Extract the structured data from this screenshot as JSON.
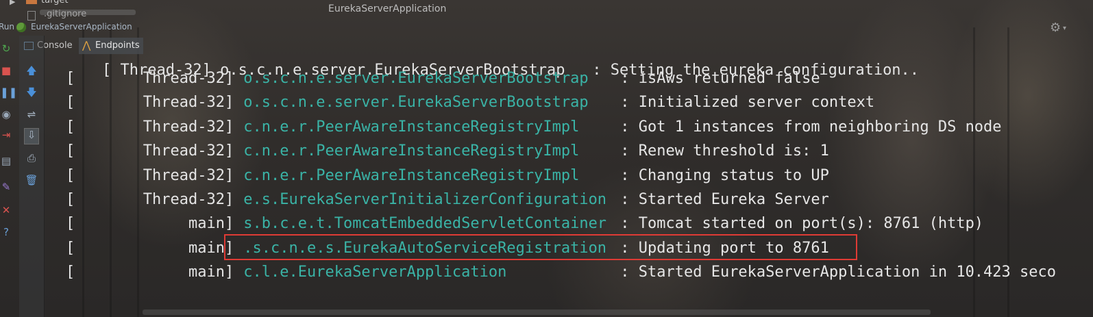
{
  "project_tree": {
    "folder_label": "target",
    "file_label": ".gitignore"
  },
  "editor": {
    "tab_title": "EurekaServerApplication"
  },
  "run_panel": {
    "label": "Run",
    "config_name": "EurekaServerApplication"
  },
  "tabs": {
    "console_label": "Console",
    "endpoints_label": "Endpoints",
    "active": "Endpoints"
  },
  "console": {
    "partial_top_line": "[ Thread-32] o.s.c.n.e.server.EurekaServerBootstrap   : Setting the eureka configuration..",
    "lines": [
      {
        "thread": "Thread-32]",
        "logger": "o.s.c.n.e.server.EurekaServerBootstrap",
        "message": ": isAws returned false"
      },
      {
        "thread": "Thread-32]",
        "logger": "o.s.c.n.e.server.EurekaServerBootstrap",
        "message": ": Initialized server context"
      },
      {
        "thread": "Thread-32]",
        "logger": "c.n.e.r.PeerAwareInstanceRegistryImpl",
        "message": ": Got 1 instances from neighboring DS node"
      },
      {
        "thread": "Thread-32]",
        "logger": "c.n.e.r.PeerAwareInstanceRegistryImpl",
        "message": ": Renew threshold is: 1"
      },
      {
        "thread": "Thread-32]",
        "logger": "c.n.e.r.PeerAwareInstanceRegistryImpl",
        "message": ": Changing status to UP"
      },
      {
        "thread": "Thread-32]",
        "logger": "e.s.EurekaServerInitializerConfiguration",
        "message": ": Started Eureka Server"
      },
      {
        "thread": "main]",
        "logger": "s.b.c.e.t.TomcatEmbeddedServletContainer",
        "message": ": Tomcat started on port(s): 8761 (http)"
      },
      {
        "thread": "main]",
        "logger": ".s.c.n.e.s.EurekaAutoServiceRegistration",
        "message": ": Updating port to 8761"
      },
      {
        "thread": "main]",
        "logger": "c.l.e.EurekaServerApplication",
        "message": ": Started EurekaServerApplication in 10.423 seco"
      }
    ],
    "highlighted_line_index": 7
  },
  "colors": {
    "logger": "#3ab3a6",
    "text": "#e4e4e4",
    "highlight_border": "#e03b35"
  },
  "icons": {
    "strip_a": [
      "rerun-icon",
      "stop-icon",
      "pause-icon",
      "dump-threads-icon",
      "exit-icon",
      "layout-icon",
      "pin-icon",
      "close-icon",
      "help-icon"
    ],
    "strip_b": [
      "up-arrow-icon",
      "down-arrow-icon",
      "soft-wrap-icon",
      "scroll-to-end-icon",
      "print-icon",
      "trash-icon"
    ]
  }
}
